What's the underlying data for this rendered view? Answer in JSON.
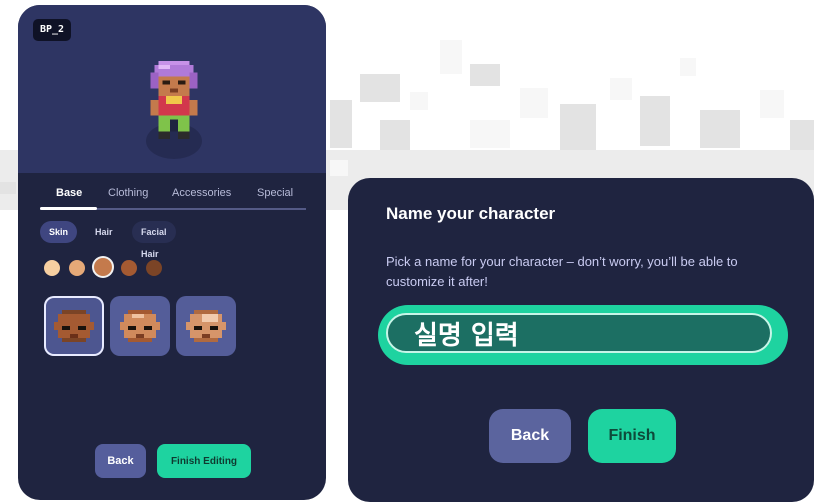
{
  "editor": {
    "badge": "BP_2",
    "tabs": [
      "Base",
      "Clothing",
      "Accessories",
      "Special"
    ],
    "active_tab": "Base",
    "subtabs": [
      "Skin",
      "Hair",
      "Facial Hair"
    ],
    "active_subtab": "Skin",
    "skin_colors": [
      "#f6cfa1",
      "#e5a978",
      "#c47a4c",
      "#a45a32",
      "#7b4426"
    ],
    "selected_skin_index": 2,
    "face_variants": 3,
    "selected_face_index": 0,
    "back_label": "Back",
    "finish_label": "Finish Editing"
  },
  "dialog": {
    "title": "Name your character",
    "description": "Pick a name for your character – don’t worry, you’ll be able to customize it after!",
    "name_value": "실명 입력",
    "back_label": "Back",
    "finish_label": "Finish"
  },
  "colors": {
    "panel": "#1f2440",
    "panel_top": "#2e3563",
    "accent": "#1ed3a0",
    "secondary_button": "#5b649e"
  }
}
